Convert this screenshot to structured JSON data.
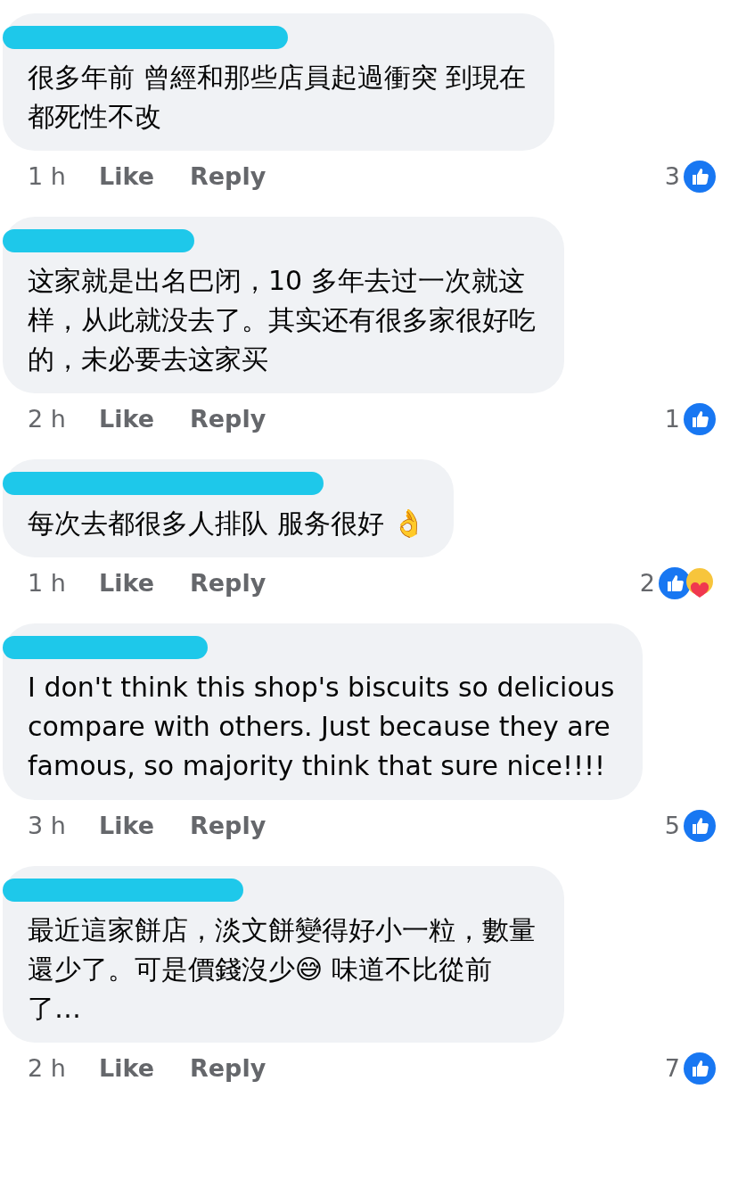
{
  "comments": [
    {
      "lines": [
        "很多年前 曾經和那些店員起過衝突  到現在",
        "都死性不改"
      ],
      "time": "1 h",
      "like": "Like",
      "reply": "Reply",
      "count": "3",
      "reactions": [
        {
          "kind": "like"
        }
      ]
    },
    {
      "lines": [
        "这家就是出名巴闭，10 多年去过一次就这",
        "样，从此就没去了。其实还有很多家很好吃",
        "的，未必要去这家买"
      ],
      "time": "2 h",
      "like": "Like",
      "reply": "Reply",
      "count": "1",
      "reactions": [
        {
          "kind": "like"
        }
      ]
    },
    {
      "lines": [
        "每次去都很多人排队 服务很好 👌"
      ],
      "time": "1 h",
      "like": "Like",
      "reply": "Reply",
      "count": "2",
      "reactions": [
        {
          "kind": "like"
        },
        {
          "kind": "care"
        }
      ]
    },
    {
      "lines": [
        "I don't think this shop's biscuits so delicious",
        "compare with others. Just because they are",
        "famous, so majority think that sure nice!!!!"
      ],
      "time": "3 h",
      "like": "Like",
      "reply": "Reply",
      "count": "5",
      "reactions": [
        {
          "kind": "like"
        }
      ]
    },
    {
      "lines": [
        "最近這家餅店，淡文餅變得好小一粒，數量",
        "還少了。可是價錢沒少😅 味道不比從前",
        "了…"
      ],
      "time": "2 h",
      "like": "Like",
      "reply": "Reply",
      "count": "7",
      "reactions": [
        {
          "kind": "like"
        }
      ]
    }
  ]
}
